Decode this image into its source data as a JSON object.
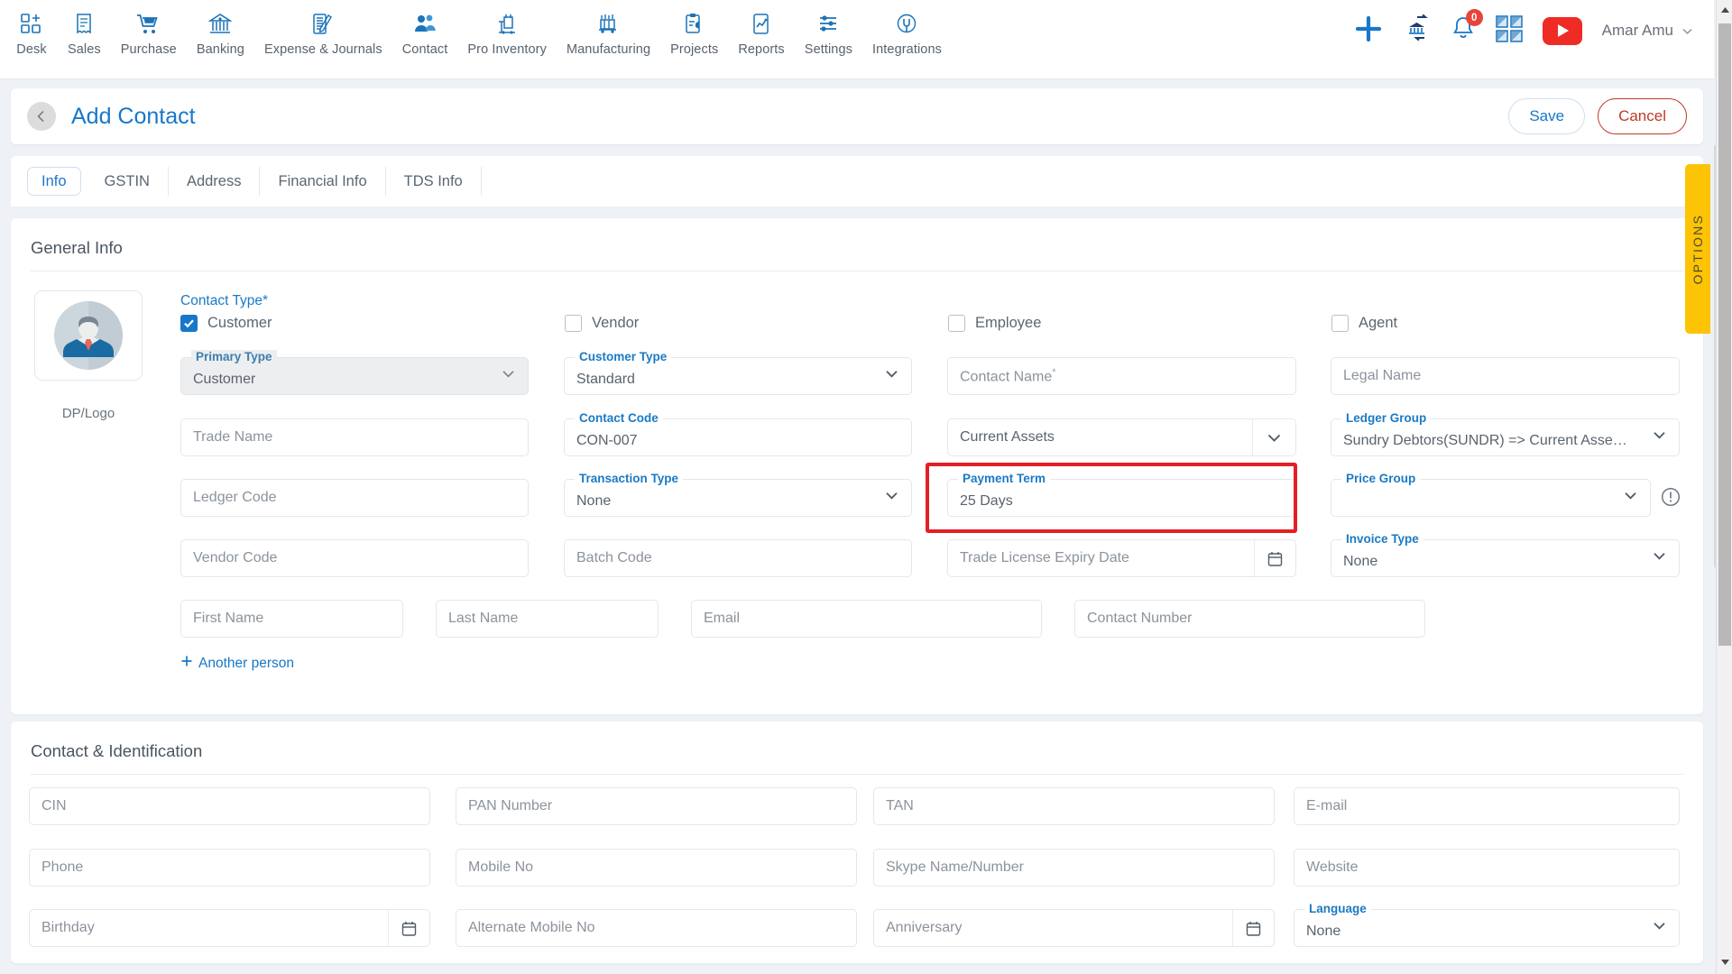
{
  "topnav": {
    "items": [
      {
        "label": "Desk",
        "icon": "desk-icon"
      },
      {
        "label": "Sales",
        "icon": "sales-receipt-icon"
      },
      {
        "label": "Purchase",
        "icon": "cart-icon"
      },
      {
        "label": "Banking",
        "icon": "bank-icon"
      },
      {
        "label": "Expense & Journals",
        "icon": "journal-icon"
      },
      {
        "label": "Contact",
        "icon": "people-icon"
      },
      {
        "label": "Pro Inventory",
        "icon": "inventory-icon"
      },
      {
        "label": "Manufacturing",
        "icon": "manufacturing-icon"
      },
      {
        "label": "Projects",
        "icon": "clipboard-icon"
      },
      {
        "label": "Reports",
        "icon": "report-chart-icon"
      },
      {
        "label": "Settings",
        "icon": "sliders-icon"
      },
      {
        "label": "Integrations",
        "icon": "plug-icon"
      }
    ],
    "actions": {
      "add": "add-plus-icon",
      "bank_transfer": "bank-transfer-icon",
      "notifications": "bell-icon",
      "notification_count": "0",
      "apps": "grid-apps-icon",
      "video": "youtube-play-icon"
    },
    "user": {
      "name": "Amar Amu",
      "caret": "chevron-down-icon"
    }
  },
  "page": {
    "back": "back-chevron-icon",
    "title": "Add Contact",
    "save_label": "Save",
    "cancel_label": "Cancel"
  },
  "tabs": [
    {
      "label": "Info",
      "active": true
    },
    {
      "label": "GSTIN",
      "active": false
    },
    {
      "label": "Address",
      "active": false
    },
    {
      "label": "Financial Info",
      "active": false
    },
    {
      "label": "TDS Info",
      "active": false
    }
  ],
  "options_tab": {
    "label": "OPTIONS"
  },
  "general_info": {
    "title": "General Info",
    "avatar_caption": "DP/Logo",
    "contact_type_label": "Contact Type*",
    "checkboxes": [
      {
        "label": "Customer",
        "checked": true
      },
      {
        "label": "Vendor",
        "checked": false
      },
      {
        "label": "Employee",
        "checked": false
      },
      {
        "label": "Agent",
        "checked": false
      }
    ],
    "fields": {
      "primary_type": {
        "label": "Primary Type",
        "value": "Customer",
        "disabled": true,
        "control": "select"
      },
      "trade_name": {
        "placeholder": "Trade Name",
        "value": "",
        "control": "text"
      },
      "ledger_code": {
        "placeholder": "Ledger Code",
        "value": "",
        "control": "text"
      },
      "vendor_code": {
        "placeholder": "Vendor Code",
        "value": "",
        "control": "text"
      },
      "customer_type": {
        "label": "Customer Type",
        "value": "Standard",
        "control": "select"
      },
      "contact_code": {
        "label": "Contact Code",
        "value": "CON-007",
        "control": "text"
      },
      "transaction_type": {
        "label": "Transaction Type",
        "value": "None",
        "control": "select"
      },
      "batch_code": {
        "placeholder": "Batch Code",
        "value": "",
        "control": "text"
      },
      "contact_name": {
        "placeholder": "Contact Name",
        "required": "*",
        "value": "",
        "control": "text"
      },
      "ledger_account": {
        "value": "Current Assets",
        "control": "select"
      },
      "payment_term": {
        "label": "Payment Term",
        "value": "25 Days",
        "control": "text",
        "highlighted": true
      },
      "trade_license_expiry": {
        "placeholder": "Trade License Expiry Date",
        "value": "",
        "control": "date"
      },
      "legal_name": {
        "placeholder": "Legal Name",
        "value": "",
        "control": "text"
      },
      "ledger_group": {
        "label": "Ledger Group",
        "value": "Sundry Debtors(SUNDR) => Current Assets(A-...",
        "control": "select"
      },
      "price_group": {
        "label": "Price Group",
        "value": "",
        "control": "select",
        "info_icon": "info-alert-icon"
      },
      "invoice_type": {
        "label": "Invoice Type",
        "value": "None",
        "control": "select"
      },
      "first_name": {
        "placeholder": "First Name",
        "value": "",
        "control": "text"
      },
      "last_name": {
        "placeholder": "Last Name",
        "value": "",
        "control": "text"
      },
      "email": {
        "placeholder": "Email",
        "value": "",
        "control": "text"
      },
      "contact_number": {
        "placeholder": "Contact Number",
        "value": "",
        "control": "text"
      }
    },
    "another_person": "Another person"
  },
  "contact_identification": {
    "title": "Contact & Identification",
    "fields": {
      "cin": {
        "placeholder": "CIN",
        "value": "",
        "control": "text"
      },
      "pan": {
        "placeholder": "PAN Number",
        "value": "",
        "control": "text"
      },
      "tan": {
        "placeholder": "TAN",
        "value": "",
        "control": "text"
      },
      "email": {
        "placeholder": "E-mail",
        "value": "",
        "control": "text"
      },
      "phone": {
        "placeholder": "Phone",
        "value": "",
        "control": "text"
      },
      "mobile": {
        "placeholder": "Mobile No",
        "value": "",
        "control": "text"
      },
      "skype": {
        "placeholder": "Skype Name/Number",
        "value": "",
        "control": "text"
      },
      "website": {
        "placeholder": "Website",
        "value": "",
        "control": "text"
      },
      "birthday": {
        "placeholder": "Birthday",
        "value": "",
        "control": "date"
      },
      "alt_mobile": {
        "placeholder": "Alternate Mobile No",
        "value": "",
        "control": "text"
      },
      "anniversary": {
        "placeholder": "Anniversary",
        "value": "",
        "control": "date"
      },
      "language": {
        "label": "Language",
        "value": "None",
        "control": "select"
      }
    }
  },
  "colors": {
    "accent_blue": "#1877c9",
    "danger_red": "#c0392b",
    "highlight_red": "#e31e25",
    "options_yellow": "#fcc404",
    "youtube_red": "#ee2b25",
    "page_bg": "#eef1f5"
  }
}
